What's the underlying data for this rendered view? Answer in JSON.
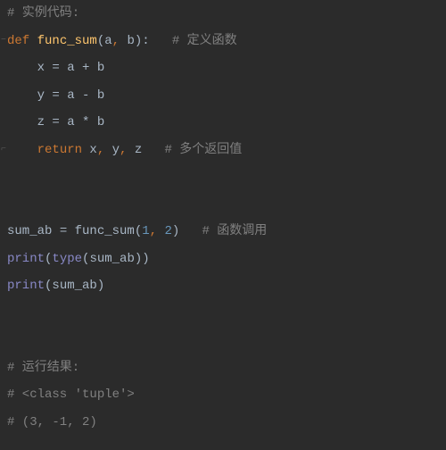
{
  "code": {
    "line1_comment": "# 实例代码:",
    "line2": {
      "def": "def ",
      "name": "func_sum",
      "open": "(",
      "p1": "a",
      "comma1": ", ",
      "p2": "b",
      "close": "):   ",
      "comment": "# 定义函数"
    },
    "line3": {
      "indent": "    ",
      "lhs": "x ",
      "eq": "= ",
      "a": "a ",
      "op": "+ ",
      "b": "b"
    },
    "line4": {
      "indent": "    ",
      "lhs": "y ",
      "eq": "= ",
      "a": "a ",
      "op": "- ",
      "b": "b"
    },
    "line5": {
      "indent": "    ",
      "lhs": "z ",
      "eq": "= ",
      "a": "a ",
      "op": "* ",
      "b": "b"
    },
    "line6": {
      "indent": "    ",
      "ret": "return ",
      "x": "x",
      "c1": ", ",
      "y": "y",
      "c2": ", ",
      "z": "z",
      "sp": "   ",
      "comment": "# 多个返回值"
    },
    "line9": {
      "lhs": "sum_ab ",
      "eq": "= ",
      "fn": "func_sum",
      "open": "(",
      "n1": "1",
      "comma": ", ",
      "n2": "2",
      "close": ")   ",
      "comment": "# 函数调用"
    },
    "line10": {
      "print": "print",
      "open": "(",
      "type": "type",
      "open2": "(",
      "arg": "sum_ab",
      "close2": ")",
      "close": ")"
    },
    "line11": {
      "print": "print",
      "open": "(",
      "arg": "sum_ab",
      "close": ")"
    },
    "line14_comment": "# 运行结果:",
    "line15_comment": "# <class 'tuple'>",
    "line16_comment": "# (3, -1, 2)"
  }
}
